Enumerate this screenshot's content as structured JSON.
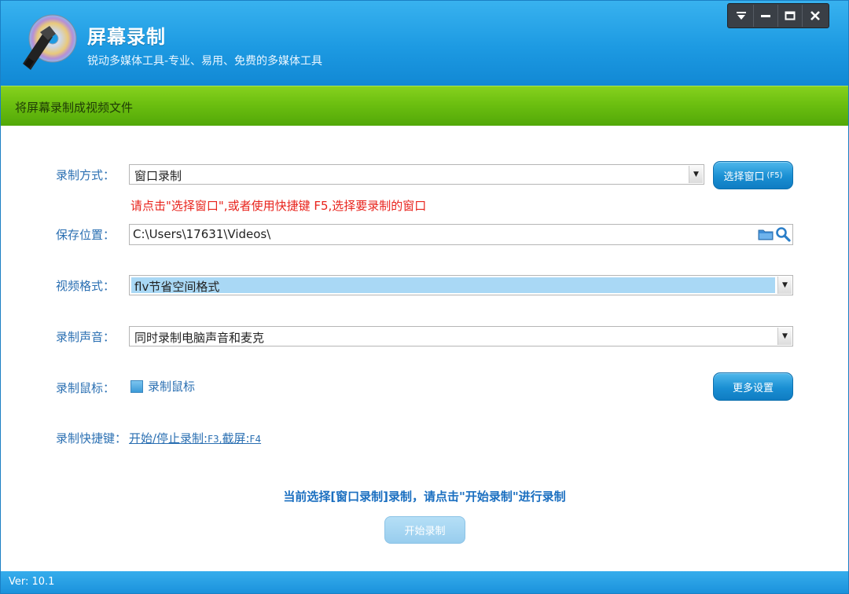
{
  "header": {
    "title": "屏幕录制",
    "subtitle": "锐动多媒体工具-专业、易用、免费的多媒体工具",
    "controls": [
      "dropdown-menu",
      "minimize",
      "maximize",
      "close"
    ]
  },
  "banner": {
    "text": "将屏幕录制成视频文件"
  },
  "form": {
    "record_mode": {
      "label": "录制方式：",
      "value": "窗口录制"
    },
    "select_window_button": {
      "label": "选择窗口",
      "shortcut": "(F5)"
    },
    "hint": "请点击\"选择窗口\",或者使用快捷键 F5,选择要录制的窗口",
    "save_location": {
      "label": "保存位置：",
      "value": "C:\\Users\\17631\\Videos\\"
    },
    "video_format": {
      "label": "视频格式：",
      "value": "flv节省空间格式"
    },
    "audio": {
      "label": "录制声音：",
      "value": "同时录制电脑声音和麦克"
    },
    "mouse": {
      "label": "录制鼠标：",
      "checkbox_label": "录制鼠标",
      "checked": true
    },
    "more_settings_button": "更多设置",
    "hotkeys": {
      "label": "录制快捷键：",
      "start_stop": "开始/停止录制:",
      "start_stop_key": "F3",
      "sep": ",",
      "screenshot": "截屏:",
      "screenshot_key": "F4"
    }
  },
  "status": {
    "message": "当前选择[窗口录制]录制，请点击\"开始录制\"进行录制"
  },
  "start_button": "开始录制",
  "footer": {
    "version": "Ver: 10.1"
  },
  "colors": {
    "header": "#1d9ae2",
    "banner": "#6cbf10",
    "label": "#2a6fb2",
    "hint": "#e8231c"
  }
}
